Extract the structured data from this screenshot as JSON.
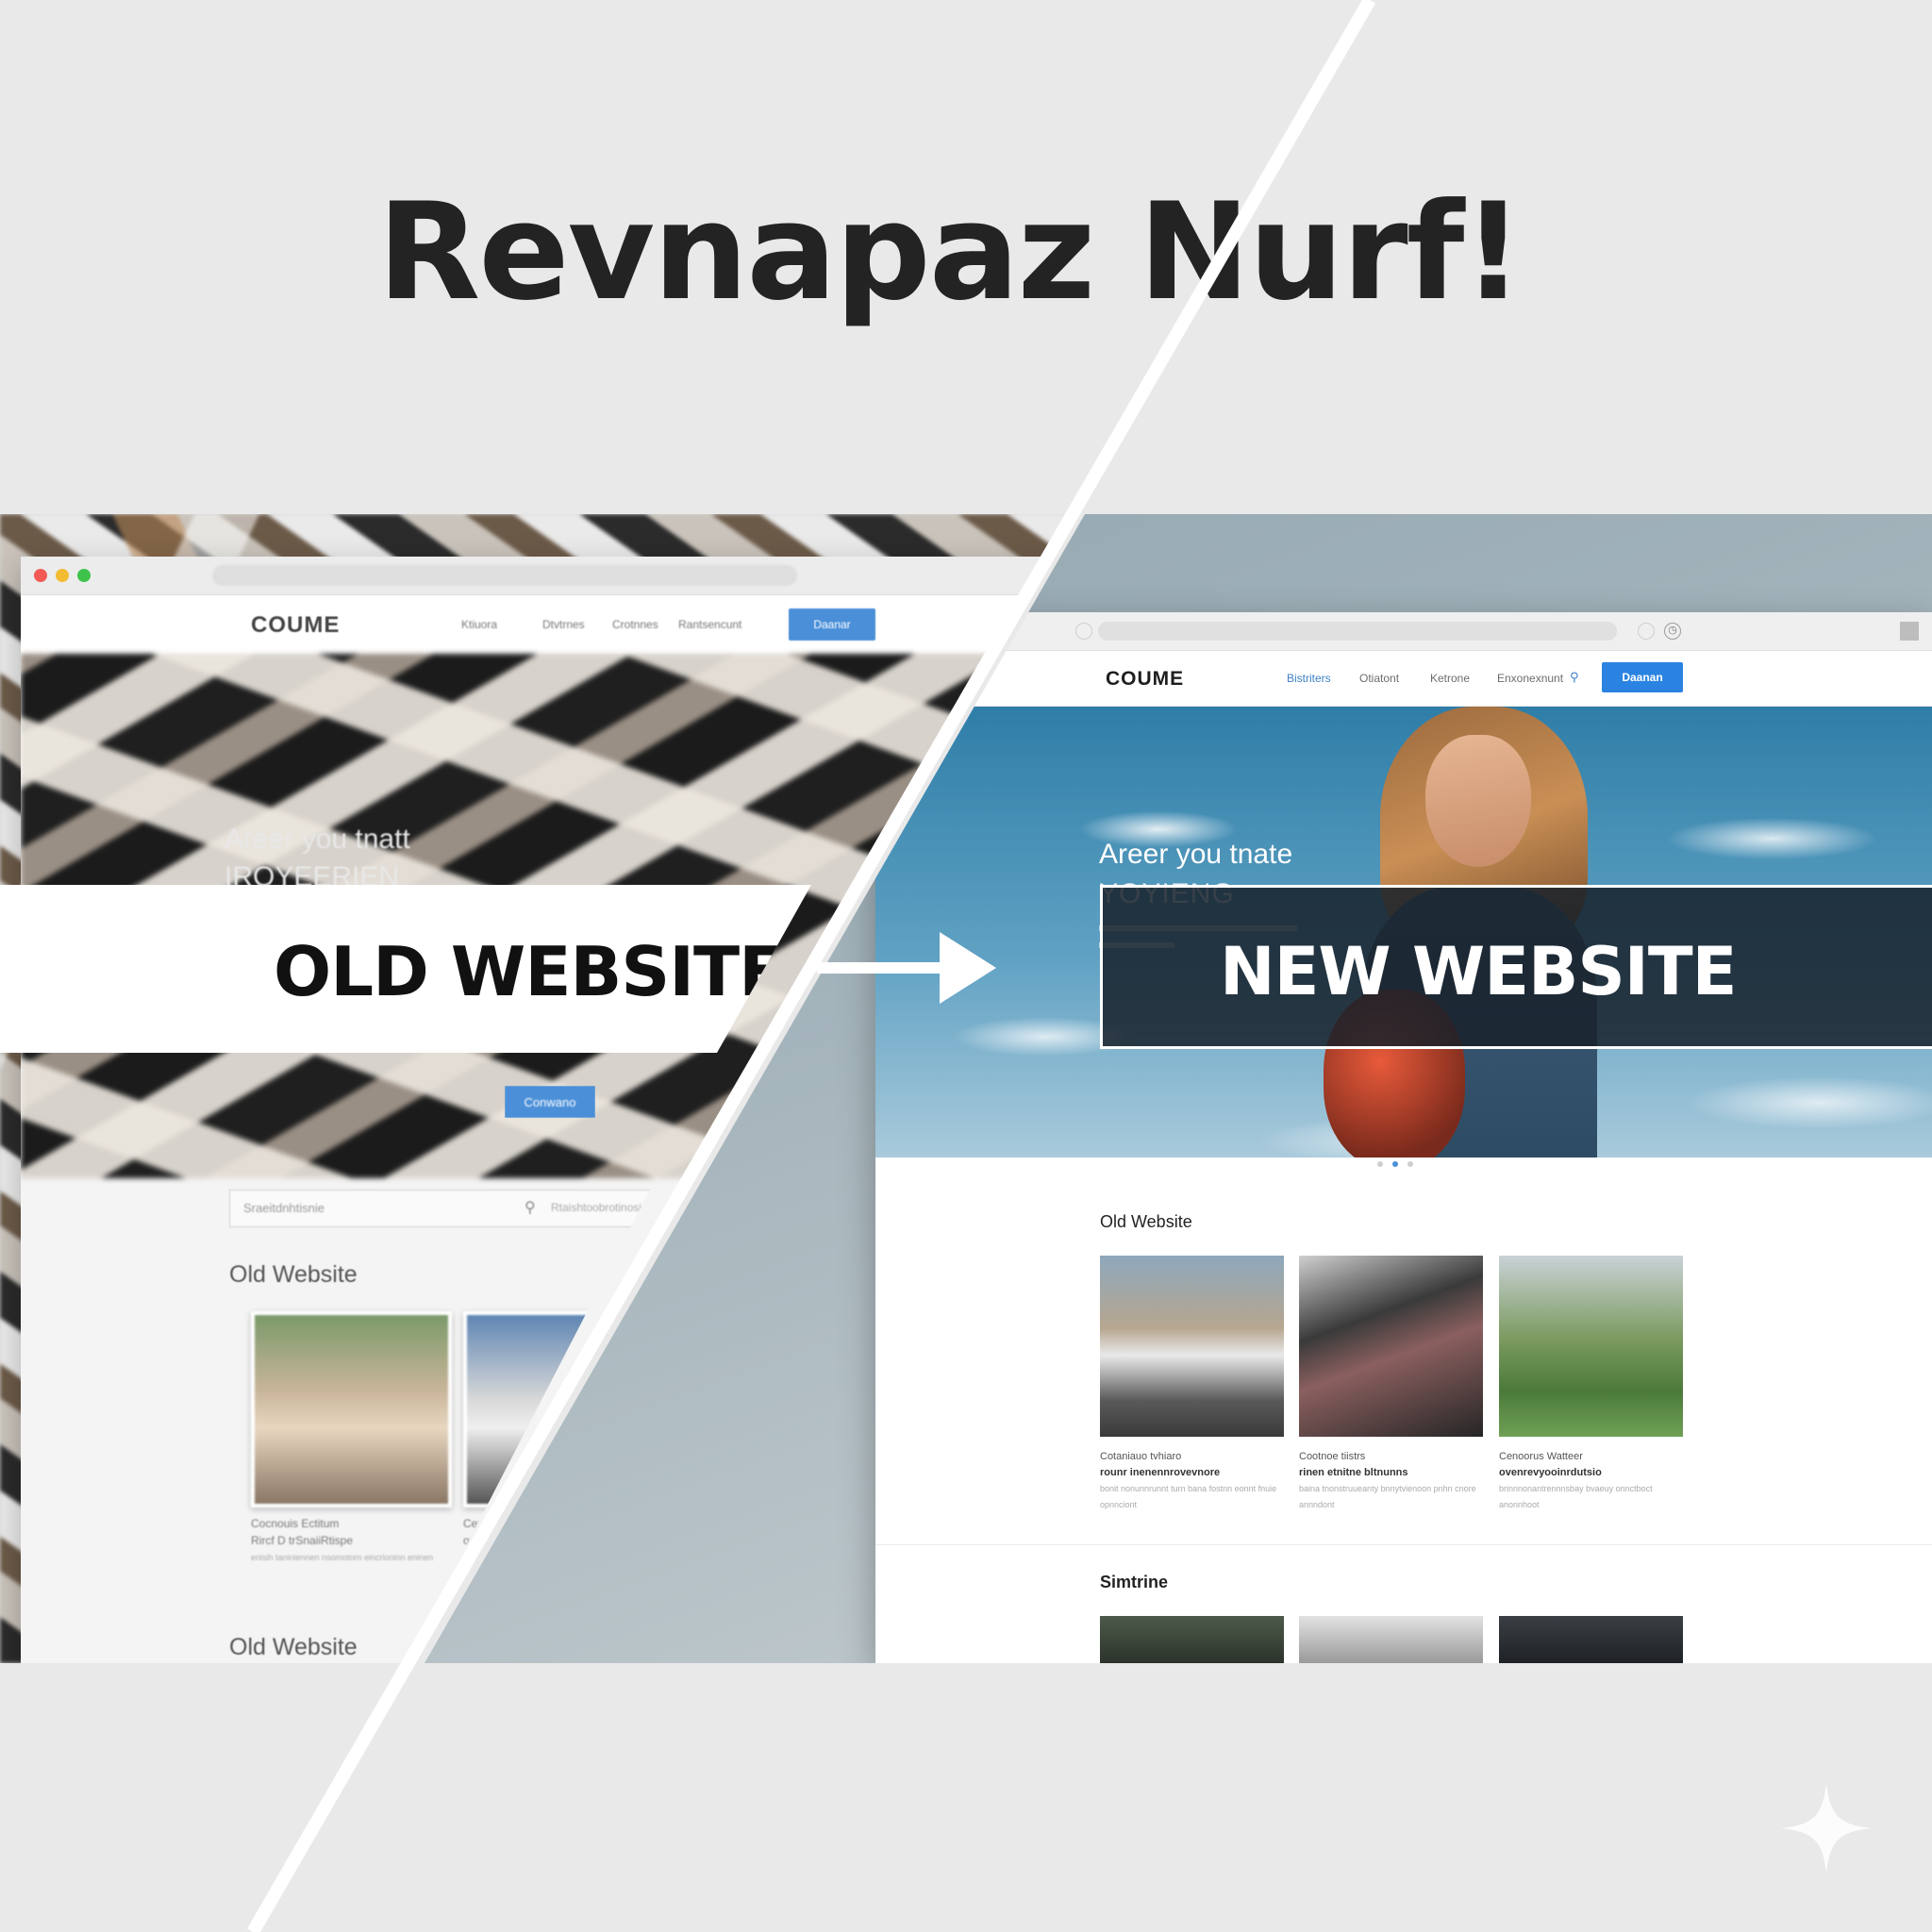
{
  "title": "Revnapaz Nurf!",
  "old_site": {
    "logo": "COUME",
    "nav": [
      "Ktiuora",
      "Dtvtrnes",
      "Crotnnes",
      "Rantsencunt"
    ],
    "cta": "Daanar",
    "hero_line1": "Areer you tnatt",
    "hero_line2": "IROYEERIEN",
    "hero_button": "Conwano",
    "search_placeholder": "Sraeitdnhtisnie",
    "search_extra": "Rtaishtoobrotinosinerotocen",
    "section_title": "Old Website",
    "section_title_2": "Old Website",
    "cards": [
      {
        "caption1": "Cocnouis Ectitum",
        "caption2": "Rircf D trSnaiiRtispe",
        "caption3": "enisih taniniennen nsomotorn eincrioninn eninen"
      },
      {
        "caption1": "Cex",
        "caption2": "or",
        "caption3": ""
      }
    ]
  },
  "new_site": {
    "logo": "COUME",
    "nav": [
      "Bistriters",
      "Otiatont",
      "Ketrone",
      "Enxonexnunt"
    ],
    "cta": "Daanan",
    "hero_line1": "Areer you tnate",
    "hero_line2": "YOYIENG",
    "section_title": "Old Website",
    "section_title_2": "Simtrine",
    "cards": [
      {
        "caption1": "Cotaniauo tvhiaro",
        "caption2": "rounr inenennrovevnore",
        "caption3": "bonit nonunnrunnt turn bana fostnn eonnt fnuie opnnciont"
      },
      {
        "caption1": "Cootnoe tiistrs",
        "caption2": "rinen etnitne bltnunns",
        "caption3": "baina tnonstruueanty bnnytvienoon pnhn cnore annndont"
      },
      {
        "caption1": "Cenoorus Watteer",
        "caption2": "ovenrevyooinrdutsio",
        "caption3": "brinnnonantrennnsbay bvaeuy onnctboct anonnhoot"
      }
    ]
  },
  "labels": {
    "old": "OLD WEBSITE",
    "new": "NEW WEBSITE"
  },
  "colors": {
    "accent": "#2a83e0",
    "divider": "#ffffff",
    "dark_label": "#18212a"
  }
}
